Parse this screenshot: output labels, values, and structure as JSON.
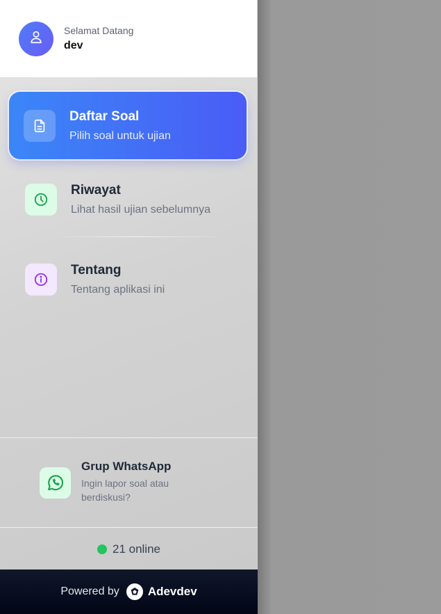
{
  "header": {
    "greeting": "Selamat Datang",
    "username": "dev",
    "avatar_icon": "user-icon"
  },
  "menu": [
    {
      "title": "Daftar Soal",
      "subtitle": "Pilih soal untuk ujian",
      "icon": "document-icon",
      "active": true
    },
    {
      "title": "Riwayat",
      "subtitle": "Lihat hasil ujian sebelumnya",
      "icon": "clock-icon",
      "active": false
    },
    {
      "title": "Tentang",
      "subtitle": "Tentang aplikasi ini",
      "icon": "info-icon",
      "active": false
    }
  ],
  "whatsapp": {
    "title": "Grup WhatsApp",
    "subtitle": "Ingin lapor soal atau berdiskusi?",
    "icon": "whatsapp-icon"
  },
  "status": {
    "online_text": "21 online",
    "dot_color": "#22c55e"
  },
  "footer": {
    "powered_by": "Powered by",
    "brand": "Adevdev"
  },
  "colors": {
    "accent_start": "#3b86f7",
    "accent_end": "#4a5cf6",
    "green": "#16a34a",
    "purple": "#9333ea"
  }
}
